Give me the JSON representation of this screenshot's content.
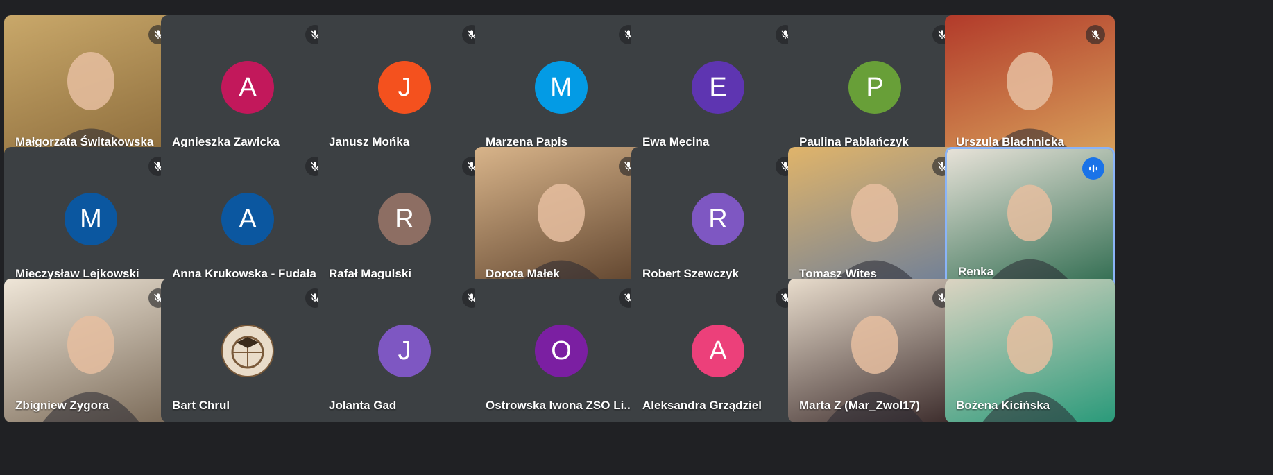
{
  "colors": {
    "background": "#202124",
    "tile": "#3c4043",
    "active_border": "#8ab4f8",
    "speaking": "#1a73e8"
  },
  "participants": [
    {
      "name": "Małgorzata Świtakowska",
      "type": "video",
      "muted": true,
      "bg": [
        "#c9a86a",
        "#8a6a3a"
      ]
    },
    {
      "name": "Agnieszka Zawicka",
      "type": "avatar",
      "initial": "A",
      "color": "#c2185b",
      "muted": true
    },
    {
      "name": "Janusz Mońka",
      "type": "avatar",
      "initial": "J",
      "color": "#f4511e",
      "muted": true
    },
    {
      "name": "Marzena Papis",
      "type": "avatar",
      "initial": "M",
      "color": "#039be5",
      "muted": true
    },
    {
      "name": "Ewa Męcina",
      "type": "avatar",
      "initial": "E",
      "color": "#5e35b1",
      "muted": true
    },
    {
      "name": "Paulina Pabiańczyk",
      "type": "avatar",
      "initial": "P",
      "color": "#689f38",
      "muted": true
    },
    {
      "name": "Urszula Blachnicka",
      "type": "video",
      "muted": true,
      "bg": [
        "#b23a2a",
        "#d9a35c"
      ]
    },
    {
      "name": "Mieczysław Lejkowski",
      "type": "avatar",
      "initial": "M",
      "color": "#0b57a0",
      "muted": true
    },
    {
      "name": "Anna Krukowska - Fudała",
      "type": "avatar",
      "initial": "A",
      "color": "#0b57a0",
      "muted": true
    },
    {
      "name": "Rafał Magulski",
      "type": "avatar",
      "initial": "R",
      "color": "#8d6e63",
      "muted": true
    },
    {
      "name": "Dorota Małek",
      "type": "video",
      "muted": true,
      "bg": [
        "#d8b48a",
        "#5a3f2a"
      ]
    },
    {
      "name": "Robert Szewczyk",
      "type": "avatar",
      "initial": "R",
      "color": "#7e57c2",
      "muted": true
    },
    {
      "name": "Tomasz Wites",
      "type": "video",
      "muted": true,
      "bg": [
        "#e0b46a",
        "#6a7d9a"
      ]
    },
    {
      "name": "Renka",
      "type": "video",
      "muted": false,
      "speaking": true,
      "bg": [
        "#e7e2d8",
        "#2e6b4f"
      ]
    },
    {
      "name": "Zbigniew Zygora",
      "type": "video",
      "muted": true,
      "bg": [
        "#efe6d8",
        "#7a6a58"
      ]
    },
    {
      "name": "Bart Chrul",
      "type": "avatar",
      "initial": "",
      "color": "#e9dcc9",
      "logo": true,
      "muted": true
    },
    {
      "name": "Jolanta Gad",
      "type": "avatar",
      "initial": "J",
      "color": "#7e57c2",
      "muted": true
    },
    {
      "name": "Ostrowska Iwona ZSO Li...",
      "type": "avatar",
      "initial": "O",
      "color": "#7b1fa2",
      "muted": true
    },
    {
      "name": "Aleksandra Grządziel",
      "type": "avatar",
      "initial": "A",
      "color": "#ec407a",
      "muted": true
    },
    {
      "name": "Marta Z (Mar_Zwol17)",
      "type": "video",
      "muted": true,
      "bg": [
        "#e8dccc",
        "#3a2a2a"
      ]
    },
    {
      "name": "Bożena Kicińska",
      "type": "video",
      "muted": false,
      "bg": [
        "#dcd4c2",
        "#2a9a7a"
      ]
    }
  ]
}
